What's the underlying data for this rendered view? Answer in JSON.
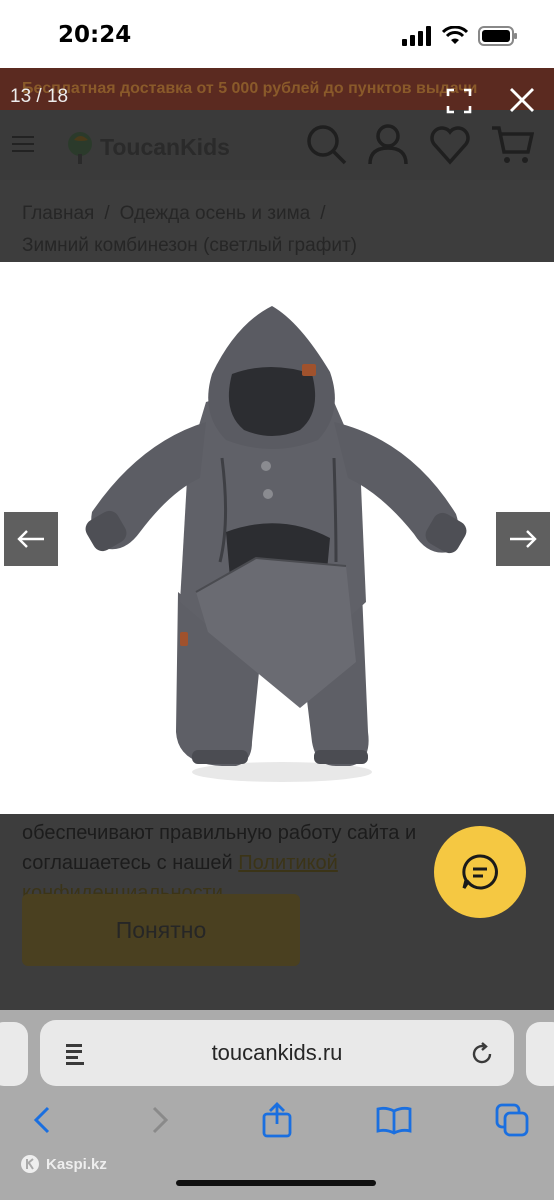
{
  "status_bar": {
    "time": "20:24"
  },
  "page": {
    "promo": "Бесплатная доставка от 5 000 рублей до пунктов выдачи",
    "logo_text": "ToucanKids",
    "breadcrumb": {
      "home": "Главная",
      "sep1": "/",
      "category": "Одежда осень и зима",
      "sep2": "/",
      "current": "Зимний комбинезон (светлый графит)"
    },
    "cookie": {
      "text": "обеспечивают правильную работу сайта и соглашаетесь с нашей",
      "link": "Политикой конфиденциальности",
      "button": "Понятно"
    }
  },
  "gallery": {
    "counter": "13 / 18",
    "image_alt": "Зимний комбинезон (светлый графит)",
    "colors": {
      "suit": "#5e5f66",
      "suit_dark": "#45464c",
      "patch": "#a0522d"
    }
  },
  "browser": {
    "url": "toucankids.ru",
    "watermark": "Kaspi.kz"
  },
  "icons": {
    "hamburger": "menu-icon",
    "search": "search-icon",
    "account": "user-icon",
    "wishlist": "heart-icon",
    "cart": "cart-icon",
    "expand": "fullscreen-icon",
    "close": "close-icon",
    "prev": "arrow-left-icon",
    "next": "arrow-right-icon",
    "chat": "chat-icon",
    "reader": "page-icon",
    "reload": "reload-icon",
    "back": "chevron-left-icon",
    "forward": "chevron-right-icon",
    "share": "share-icon",
    "bookmarks": "book-icon",
    "tabs": "tabs-icon"
  }
}
